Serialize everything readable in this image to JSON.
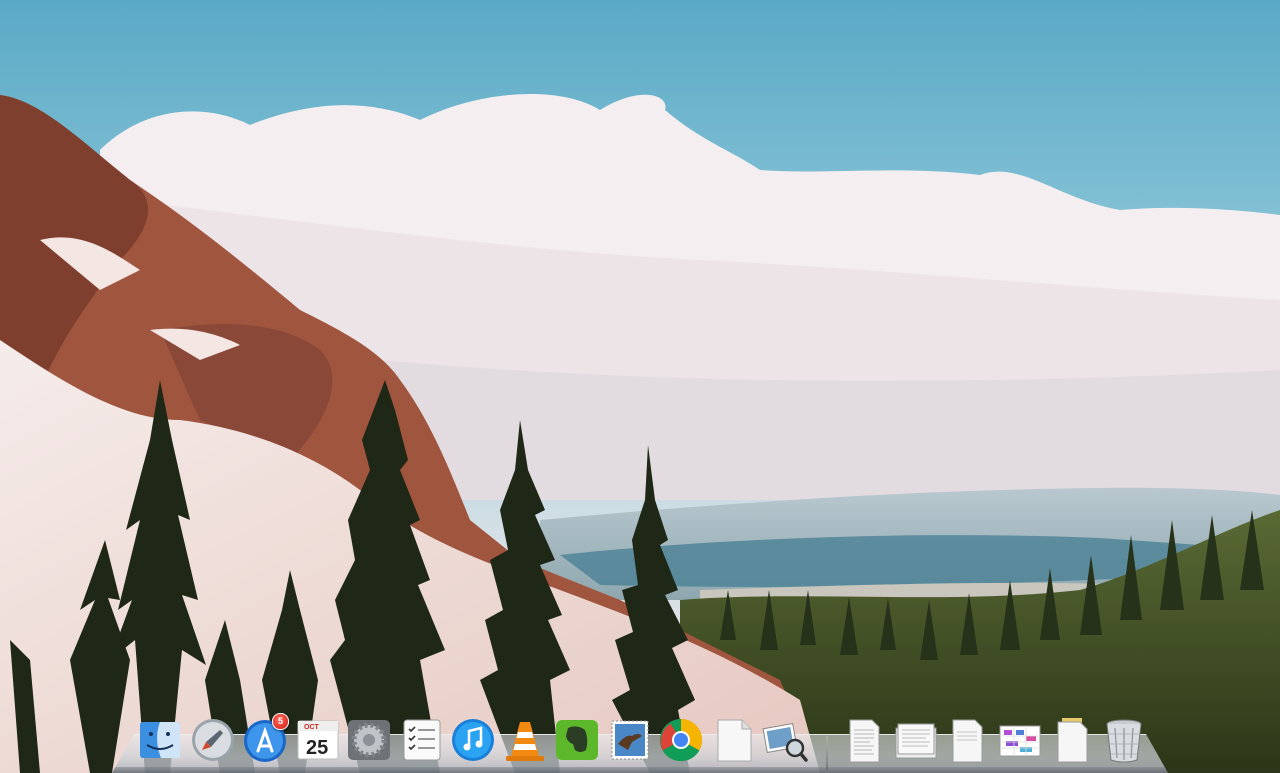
{
  "desktop": {
    "wallpaper": "mountain-forest-landscape"
  },
  "dock": {
    "apps": [
      {
        "id": "finder",
        "icon": "finder-icon"
      },
      {
        "id": "launchpad",
        "icon": "launchpad-icon"
      },
      {
        "id": "app-store",
        "icon": "app-store-icon",
        "badge": "5"
      },
      {
        "id": "calendar",
        "icon": "calendar-icon",
        "month": "OCT",
        "day": "25"
      },
      {
        "id": "system-preferences",
        "icon": "gear-icon"
      },
      {
        "id": "reminders",
        "icon": "checklist-icon"
      },
      {
        "id": "itunes",
        "icon": "music-note-icon"
      },
      {
        "id": "vlc",
        "icon": "traffic-cone-icon"
      },
      {
        "id": "evernote",
        "icon": "elephant-icon"
      },
      {
        "id": "mail",
        "icon": "eagle-stamp-icon"
      },
      {
        "id": "chrome",
        "icon": "chrome-icon"
      },
      {
        "id": "textedit",
        "icon": "blank-document-icon"
      },
      {
        "id": "preview",
        "icon": "photos-loupe-icon"
      }
    ],
    "documents": [
      {
        "id": "doc-1",
        "icon": "document-icon"
      },
      {
        "id": "doc-2",
        "icon": "document-stack-icon"
      },
      {
        "id": "doc-3",
        "icon": "document-icon"
      },
      {
        "id": "doc-4",
        "icon": "spreadsheet-icon"
      },
      {
        "id": "doc-5",
        "icon": "folder-document-icon"
      },
      {
        "id": "trash",
        "icon": "trash-icon"
      }
    ]
  },
  "colors": {
    "sky": "#6fb6cf",
    "cloud": "#f4eef0",
    "forest": "#2f3b1e",
    "snow": "#f1e4e2",
    "rock": "#a0553f",
    "badge": "#d31b10"
  }
}
